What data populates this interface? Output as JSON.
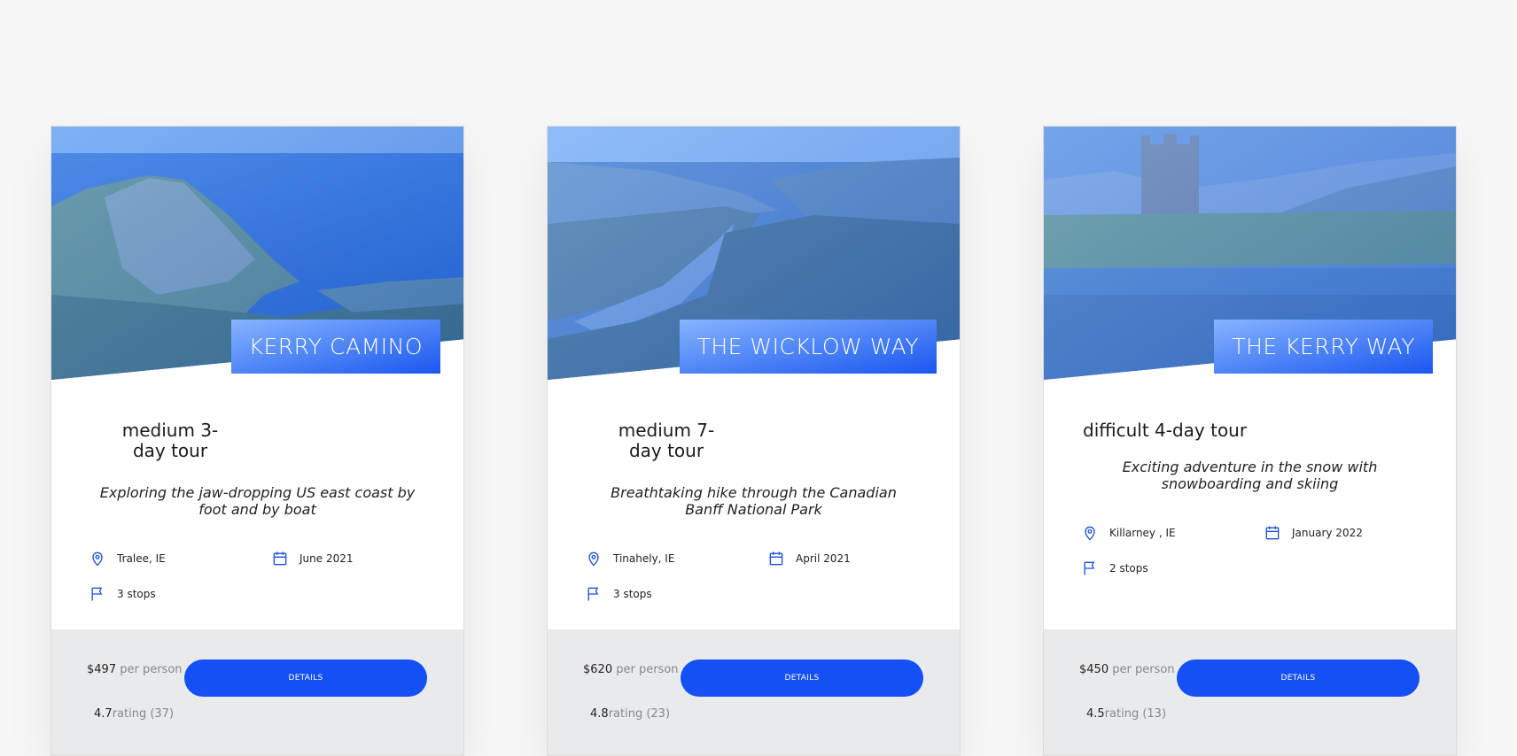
{
  "tours": [
    {
      "name": "KERRY CAMINO",
      "difficulty_line": "medium 3-day tour",
      "summary": "Exploring the jaw-dropping US east coast by foot and by boat",
      "location": "Tralee, IE",
      "date": "June 2021",
      "stops": "3 stops",
      "price_value": "$497",
      "price_unit": " per person",
      "rating_value": "4.7",
      "rating_unit": "rating (37)",
      "button_label": "DETAILS"
    },
    {
      "name": "THE WICKLOW WAY",
      "difficulty_line": "medium 7-day tour",
      "summary": "Breathtaking hike through the Canadian Banff National Park",
      "location": "Tinahely, IE",
      "date": "April 2021",
      "stops": "3 stops",
      "price_value": "$620",
      "price_unit": " per person",
      "rating_value": "4.8",
      "rating_unit": "rating (23)",
      "button_label": "DETAILS"
    },
    {
      "name": "THE KERRY WAY",
      "difficulty_line": "difficult 4-day tour",
      "summary": "Exciting adventure in the snow with snowboarding and skiing",
      "location": "Killarney , IE",
      "date": "January 2022",
      "stops": "2 stops",
      "price_value": "$450",
      "price_unit": " per person",
      "rating_value": "4.5",
      "rating_unit": "rating (13)",
      "button_label": "DETAILS"
    }
  ],
  "icons": {
    "location": "map-pin-icon",
    "date": "calendar-icon",
    "stops": "flag-icon"
  },
  "colors": {
    "accent": "#1550f5",
    "name_box_start": "#86b4ff",
    "name_box_end": "#1a57f0",
    "footer_bg": "#e9eaec",
    "icon": "#1d4fd8"
  }
}
